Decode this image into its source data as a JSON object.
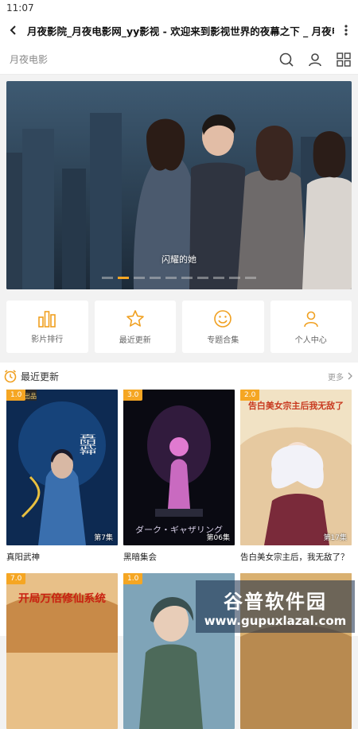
{
  "status_bar": {
    "time": "11:07"
  },
  "top_bar": {
    "title": "月夜影院_月夜电影网_yy影视 - 欢迎来到影视世界的夜幕之下 _ 月夜电影"
  },
  "site_header": {
    "logo": "月夜电影"
  },
  "banner": {
    "caption": "闪耀的她",
    "slide_count": 10,
    "active_slide": 2
  },
  "quick_nav": [
    {
      "label": "影片排行",
      "icon": "bar-chart-icon"
    },
    {
      "label": "最近更新",
      "icon": "star-icon"
    },
    {
      "label": "专题合集",
      "icon": "smile-icon"
    },
    {
      "label": "个人中心",
      "icon": "user-icon"
    }
  ],
  "section": {
    "title": "最近更新",
    "more": "更多",
    "icon": "clock-icon"
  },
  "cards": [
    {
      "rating": "1.0",
      "episode": "第7集",
      "title": "真阳武神",
      "tag": "出品",
      "poster_text": "真阳武神"
    },
    {
      "rating": "3.0",
      "episode": "第06集",
      "title": "黑暗集会",
      "poster_text": "ダーク・ギャザリング"
    },
    {
      "rating": "2.0",
      "episode": "第17集",
      "title": "告白美女宗主后，我无敌了？",
      "poster_text": "告白美女宗主后我无敌了"
    },
    {
      "rating": "7.0",
      "episode": "",
      "title": "",
      "poster_text": "开局万倍修仙系统"
    },
    {
      "rating": "1.0",
      "episode": "",
      "title": ""
    }
  ],
  "watermark": {
    "logo": "谷普软件园",
    "url": "www.gupuxlazal.com"
  },
  "colors": {
    "accent": "#f5a623",
    "icon_orange": "#f0a020"
  }
}
